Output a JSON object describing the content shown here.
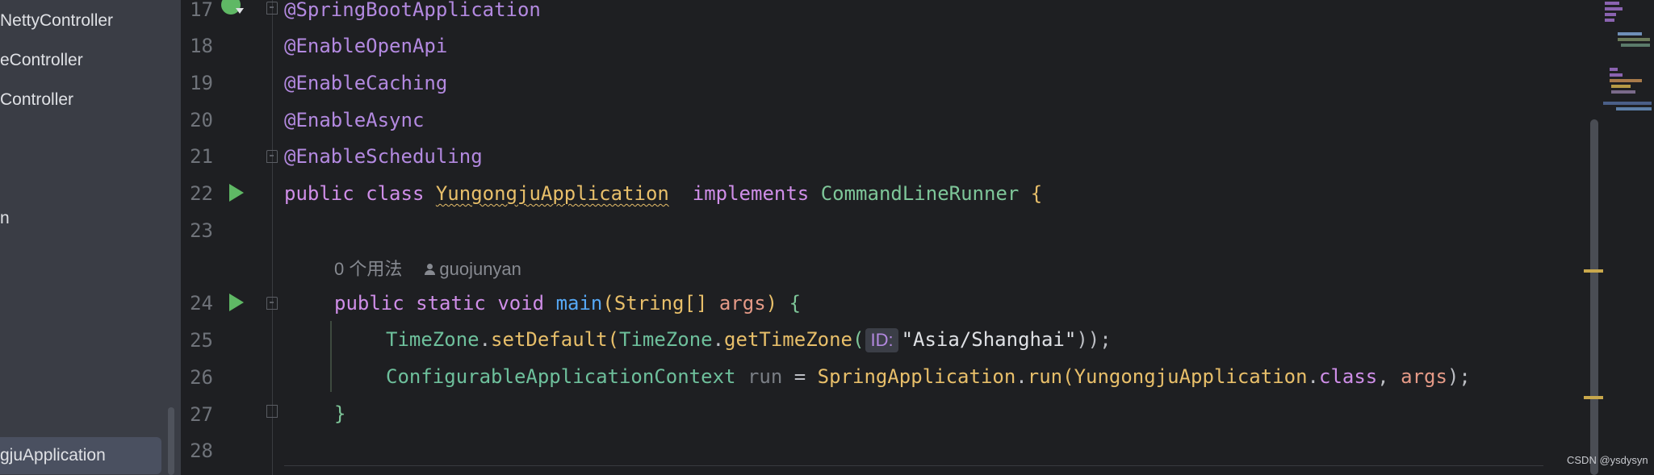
{
  "sidebar": {
    "items": [
      {
        "label": "NettyController"
      },
      {
        "label": "eController"
      },
      {
        "label": "Controller"
      },
      {
        "label": "n"
      },
      {
        "label": "gjuApplication"
      }
    ]
  },
  "editor": {
    "line_numbers": [
      "17",
      "18",
      "19",
      "20",
      "21",
      "22",
      "23",
      "24",
      "25",
      "26",
      "27",
      "28"
    ],
    "usage_hint": {
      "count": "0 个用法",
      "author": "guojunyan"
    },
    "code": {
      "l17": "@SpringBootApplication",
      "l18": "@EnableOpenApi",
      "l19": "@EnableCaching",
      "l20": "@EnableAsync",
      "l21": "@EnableScheduling",
      "l22": {
        "kw1": "public",
        "kw2": "class",
        "cls": "YungongjuApplication",
        "kw3": "implements",
        "iface": "CommandLineRunner",
        "brace": "{"
      },
      "l24": {
        "kw1": "public",
        "kw2": "static",
        "kw3": "void",
        "fn": "main",
        "p1": "(",
        "type": "String[]",
        "param": "args",
        "p2": ")",
        "brace": "{"
      },
      "l25": {
        "type1": "TimeZone",
        "dot1": ".",
        "m1": "setDefault",
        "p1": "(",
        "type2": "TimeZone",
        "dot2": ".",
        "m2": "getTimeZone",
        "p2": "(",
        "hint": "ID:",
        "str": "\"Asia/Shanghai\"",
        "end": "));"
      },
      "l26": {
        "type": "ConfigurableApplicationContext",
        "var": "run",
        "eq": " = ",
        "cls1": "SpringApplication",
        "dot1": ".",
        "m": "run",
        "p1": "(",
        "cls2": "YungongjuApplication",
        "dot2": ".",
        "kw": "class",
        "comma": ", ",
        "param": "args",
        "end": ");"
      },
      "l27": "}"
    }
  },
  "watermark": "CSDN @ysdysyn",
  "colors": {
    "annotation": "#b389e0",
    "keyword": "#cf8ee8",
    "class": "#e8bf6a",
    "function": "#56a8f5",
    "run_icon": "#5fb865"
  },
  "icons": [
    "run-icon",
    "spring-bean-icon",
    "fold-icon",
    "person-icon"
  ]
}
